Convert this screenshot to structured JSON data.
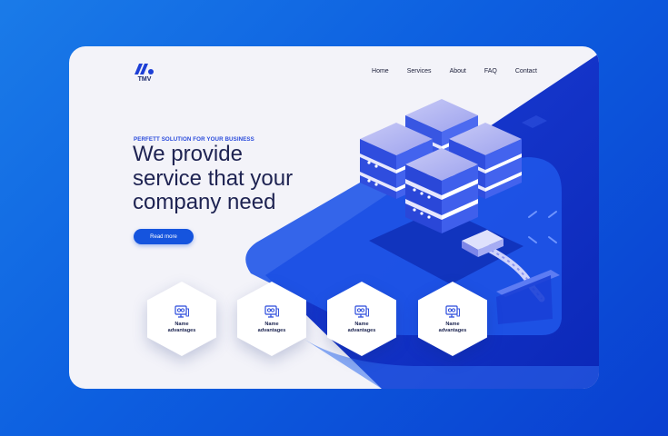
{
  "brand": {
    "name": "TMV"
  },
  "nav": {
    "items": [
      "Home",
      "Services",
      "About",
      "FAQ",
      "Contact"
    ]
  },
  "hero": {
    "subtitle": "PERFETT SOLUTION FOR YOUR BUSINESS",
    "headline_lines": [
      "We provide",
      "service that your",
      "company need"
    ],
    "cta_label": "Read more"
  },
  "advantages": [
    {
      "label": "Name advantages",
      "icon": "monitor-icon"
    },
    {
      "label": "Name advantages",
      "icon": "monitor-icon"
    },
    {
      "label": "Name advantages",
      "icon": "monitor-icon"
    },
    {
      "label": "Name advantages",
      "icon": "monitor-icon"
    }
  ],
  "colors": {
    "page_bg": "#0d5fe0",
    "card_bg": "#f3f3f9",
    "accent": "#1554de",
    "heading": "#1e2352",
    "subtitle": "#2a4bdc"
  }
}
